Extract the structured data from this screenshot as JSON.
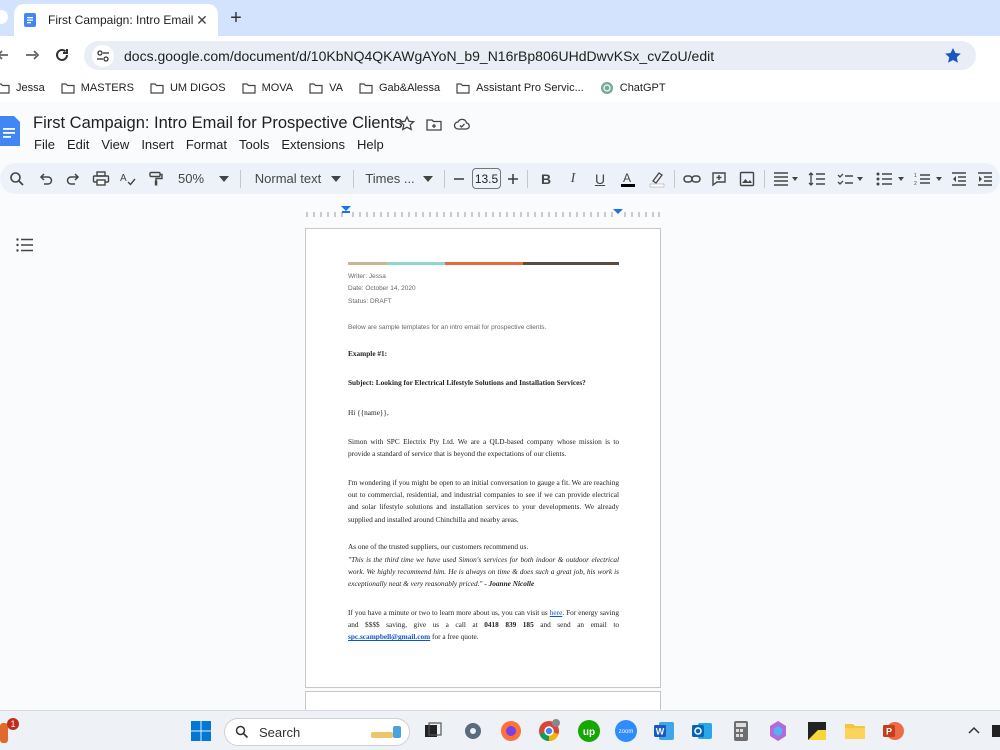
{
  "browser": {
    "tab_title": "First Campaign: Intro Email for Prospective Clients",
    "url": "docs.google.com/document/d/10KbNQ4QKAWgAYoN_b9_N16rBp806UHdDwvKSx_cvZoU/edit",
    "bookmarks": [
      "Jessa",
      "MASTERS",
      "UM DIGOS",
      "MOVA",
      "VA",
      "Gab&Alessa",
      "Assistant Pro Servic...",
      "ChatGPT"
    ]
  },
  "docs": {
    "title": "First Campaign: Intro Email for Prospective Clients",
    "menu": [
      "File",
      "Edit",
      "View",
      "Insert",
      "Format",
      "Tools",
      "Extensions",
      "Help"
    ],
    "toolbar": {
      "zoom": "50%",
      "style": "Normal text",
      "font": "Times ...",
      "font_size": "13.5"
    }
  },
  "document": {
    "color_bar": [
      "#c9b68a",
      "#8fd6cf",
      "#e8693a",
      "#5a4d3e"
    ],
    "writer": "Writer: Jessa",
    "date": "Date: October 14, 2020",
    "status": "Status: DRAFT",
    "intro": "Below are sample templates for an intro email for prospective clients.",
    "example_heading": "Example #1:",
    "subject": "Subject: Looking for Electrical Lifestyle Solutions and Installation Services?",
    "greeting": "Hi {{name}},",
    "para1": "Simon with SPC Electrix Pty Ltd. We are a QLD-based company whose mission is to provide a standard of service that is beyond the expectations of our clients.",
    "para2": "I'm wondering if you might be open to an initial conversation to gauge a fit. We are reaching out to commercial, residential, and industrial companies to see if we can provide electrical and solar lifestyle solutions and installation services to your developments. We already supplied and installed around Chinchilla and nearby areas.",
    "para3": "As one of the trusted suppliers, our customers recommend us.",
    "quote": "\"This is the third time we have used Simon's services for both indoor & outdoor electrical work. We highly recommend him. He is always on time & does such a great job, his work is exceptionally neat & very reasonably priced.\"",
    "quote_author": " - Joanne Nicolle",
    "para4_a": "If you have a minute or two to learn more about us, you can visit us ",
    "para4_link": "here",
    "para4_b": ". For energy saving and $$$$ saving,  give us a call at ",
    "phone": "0418 839 185",
    "para4_c": " and send an email to ",
    "email": "spc.scampbell@gmail.com",
    "para4_d": " for a free quote."
  },
  "taskbar": {
    "search_placeholder": "Search",
    "notification_count": "1"
  }
}
